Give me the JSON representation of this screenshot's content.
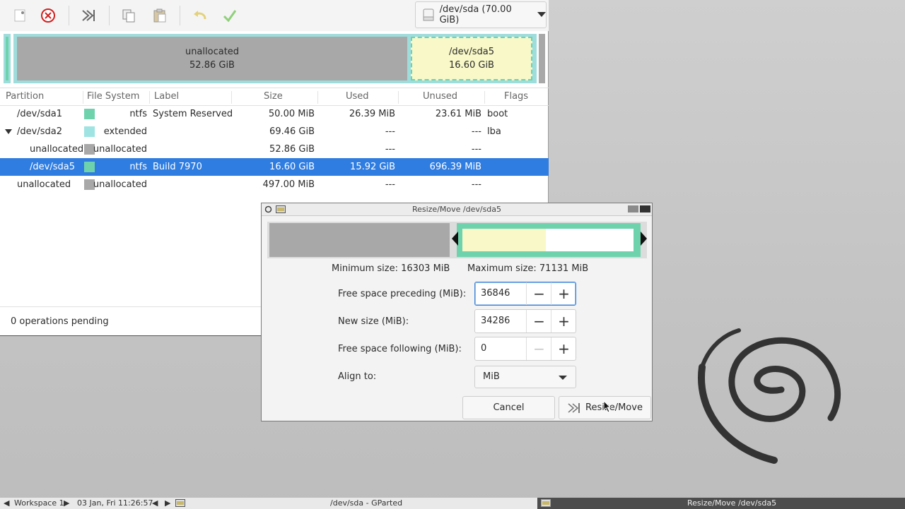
{
  "toolbar": {
    "icons": [
      "new-icon",
      "delete-icon",
      "resize-move-icon",
      "copy-icon",
      "paste-icon",
      "undo-icon",
      "apply-icon"
    ],
    "device_label": "/dev/sda (70.00 GiB)"
  },
  "disk_map": {
    "unallocated_label": "unallocated",
    "unallocated_size": "52.86 GiB",
    "sda5_label": "/dev/sda5",
    "sda5_size": "16.60 GiB"
  },
  "table": {
    "columns": [
      "Partition",
      "File System",
      "Label",
      "Size",
      "Used",
      "Unused",
      "Flags"
    ],
    "rows": [
      {
        "partition": "/dev/sda1",
        "fs": "ntfs",
        "color": "#6ed3ad",
        "label": "System Reserved",
        "size": "50.00 MiB",
        "used": "26.39 MiB",
        "unused": "23.61 MiB",
        "flags": "boot"
      },
      {
        "partition": "/dev/sda2",
        "fs": "extended",
        "color": "#9fe3e3",
        "label": "",
        "size": "69.46 GiB",
        "used": "---",
        "unused": "---",
        "flags": "lba"
      },
      {
        "partition": "unallocated",
        "fs": "unallocated",
        "color": "#a8a8a8",
        "label": "",
        "size": "52.86 GiB",
        "used": "---",
        "unused": "---",
        "flags": ""
      },
      {
        "partition": "/dev/sda5",
        "fs": "ntfs",
        "color": "#6ed3ad",
        "label": "Build 7970",
        "size": "16.60 GiB",
        "used": "15.92 GiB",
        "unused": "696.39 MiB",
        "flags": ""
      },
      {
        "partition": "unallocated",
        "fs": "unallocated",
        "color": "#a8a8a8",
        "label": "",
        "size": "497.00 MiB",
        "used": "---",
        "unused": "---",
        "flags": ""
      }
    ]
  },
  "status": {
    "operations": "0 operations pending"
  },
  "dialog": {
    "title": "Resize/Move /dev/sda5",
    "min_size": "Minimum size: 16303 MiB",
    "max_size": "Maximum size: 71131 MiB",
    "free_preceding_label": "Free space preceding (MiB):",
    "free_preceding_value": "36846",
    "new_size_label": "New size (MiB):",
    "new_size_value": "34286",
    "free_following_label": "Free space following (MiB):",
    "free_following_value": "0",
    "align_label": "Align to:",
    "align_value": "MiB",
    "cancel_label": "Cancel",
    "resize_label": "Resize/Move"
  },
  "panel": {
    "workspace": "Workspace 1",
    "datetime": "03 Jan, Fri 11:26:57",
    "task1": "/dev/sda - GParted",
    "task2": "Resize/Move /dev/sda5"
  },
  "colors": {
    "selection": "#2f7de1",
    "ntfs": "#6ed3ad",
    "extended": "#9fdcdc",
    "unallocated": "#a8a8a8",
    "used": "#f8f8c8"
  }
}
